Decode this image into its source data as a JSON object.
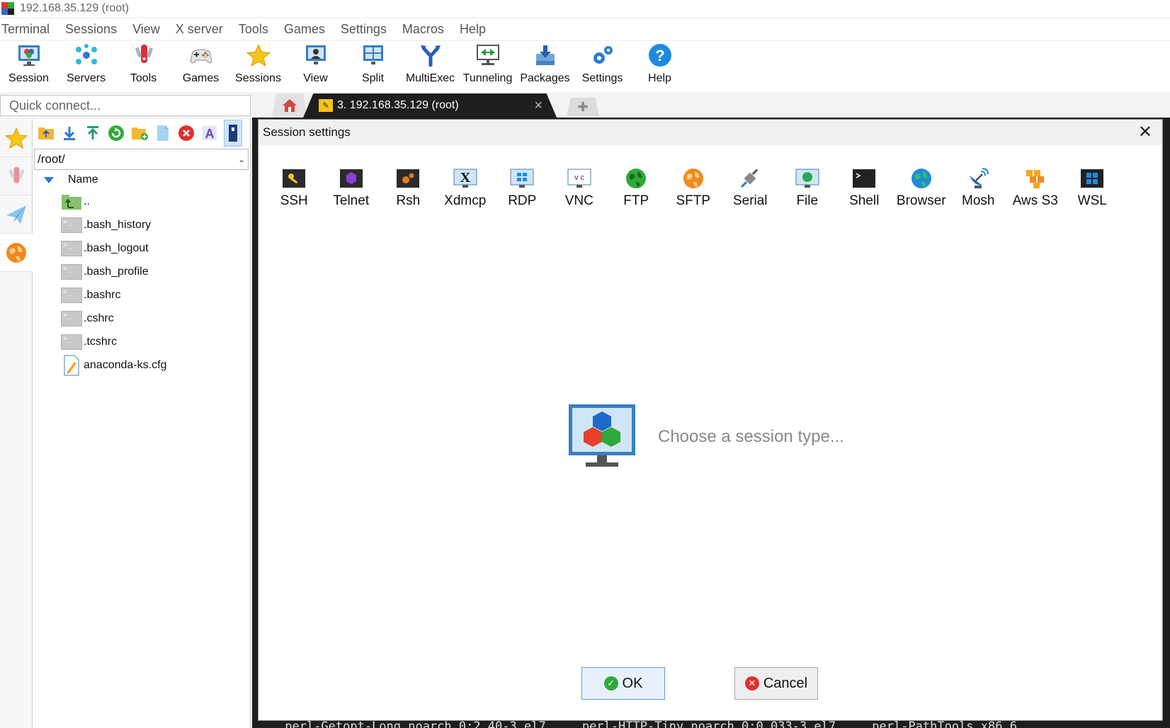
{
  "window": {
    "title": "192.168.35.129 (root)"
  },
  "menu": [
    "Terminal",
    "Sessions",
    "View",
    "X server",
    "Tools",
    "Games",
    "Settings",
    "Macros",
    "Help"
  ],
  "toolbar": {
    "session": "Session",
    "servers": "Servers",
    "tools": "Tools",
    "games": "Games",
    "sessions": "Sessions",
    "view": "View",
    "split": "Split",
    "multiexec": "MultiExec",
    "tunneling": "Tunneling",
    "packages": "Packages",
    "settings": "Settings",
    "help": "Help"
  },
  "quick_connect": {
    "placeholder": "Quick connect..."
  },
  "tabs": {
    "active_label": "3. 192.168.35.129 (root)",
    "close": "×"
  },
  "file_browser": {
    "path": "/root/",
    "column_header": "Name",
    "files": [
      {
        "name": "..",
        "type": "parent"
      },
      {
        "name": ".bash_history",
        "type": "terminal"
      },
      {
        "name": ".bash_logout",
        "type": "terminal"
      },
      {
        "name": ".bash_profile",
        "type": "terminal"
      },
      {
        "name": ".bashrc",
        "type": "terminal"
      },
      {
        "name": ".cshrc",
        "type": "terminal"
      },
      {
        "name": ".tcshrc",
        "type": "terminal"
      },
      {
        "name": "anaconda-ks.cfg",
        "type": "config"
      }
    ]
  },
  "dialog": {
    "title": "Session settings",
    "session_types": {
      "ssh": "SSH",
      "telnet": "Telnet",
      "rsh": "Rsh",
      "xdmcp": "Xdmcp",
      "rdp": "RDP",
      "vnc": "VNC",
      "ftp": "FTP",
      "sftp": "SFTP",
      "serial": "Serial",
      "file": "File",
      "shell": "Shell",
      "browser": "Browser",
      "mosh": "Mosh",
      "aws_s3": "Aws S3",
      "wsl": "WSL"
    },
    "prompt": "Choose a session type...",
    "ok_label": "OK",
    "cancel_label": "Cancel"
  },
  "terminal_bottom_text": " perl-Getopt-Long.noarch 0:2.40-3.el7     perl-HTTP-Tiny.noarch 0:0.033-3.el7     perl-PathTools.x86_6",
  "colors": {
    "accent": "#2a7ad5",
    "terminal_bg": "#1e1e1e",
    "ok_icon": "#2eaa3a",
    "cancel_icon": "#e0302e"
  }
}
